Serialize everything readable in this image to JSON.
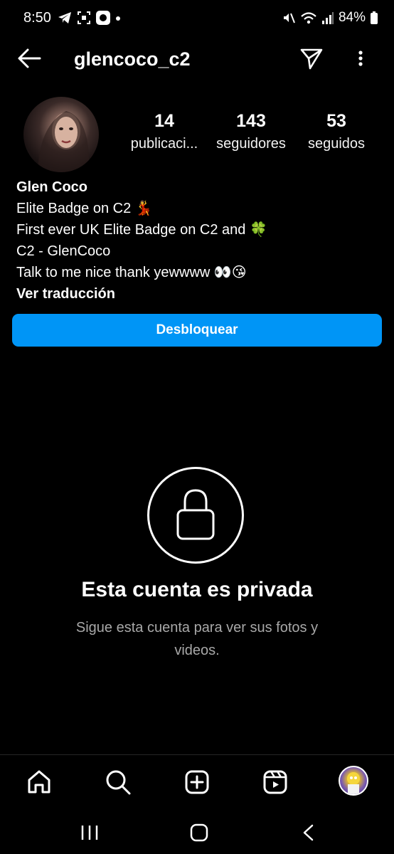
{
  "status_bar": {
    "time": "8:50",
    "battery": "84%"
  },
  "header": {
    "username": "glencoco_c2"
  },
  "profile": {
    "stats": [
      {
        "value": "14",
        "label": "publicaci..."
      },
      {
        "value": "143",
        "label": "seguidores"
      },
      {
        "value": "53",
        "label": "seguidos"
      }
    ],
    "name": "Glen Coco",
    "bio_lines": [
      "Elite Badge on C2 💃",
      "First ever UK Elite Badge on C2 and 🍀",
      "C2 - GlenCoco",
      "Talk to me nice thank yewwww 👀😘"
    ],
    "translate_label": "Ver traducción"
  },
  "actions": {
    "unblock_label": "Desbloquear"
  },
  "private": {
    "title": "Esta cuenta es privada",
    "subtitle": "Sigue esta cuenta para ver sus fotos y videos."
  },
  "colors": {
    "accent": "#0095f6",
    "background": "#000000",
    "muted_text": "#a8a8a8"
  },
  "bottom_nav": {
    "items": [
      "home-icon",
      "search-icon",
      "create-icon",
      "reels-icon",
      "profile-avatar"
    ]
  },
  "system_nav": {
    "items": [
      "recent-apps-icon",
      "home-button-icon",
      "back-icon"
    ]
  }
}
